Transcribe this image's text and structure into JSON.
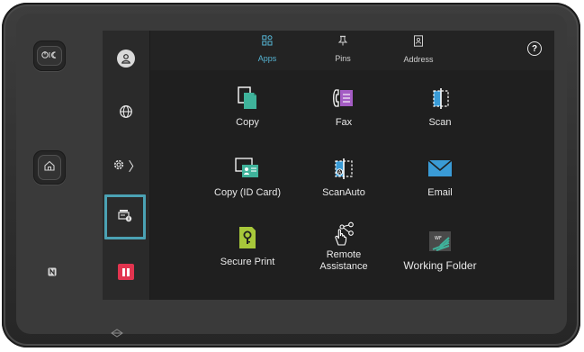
{
  "tabs": [
    {
      "label": "Apps",
      "icon": "apps-grid-icon",
      "active": true
    },
    {
      "label": "Pins",
      "icon": "pin-icon",
      "active": false
    },
    {
      "label": "Address",
      "icon": "address-book-icon",
      "active": false
    }
  ],
  "help_glyph": "?",
  "sidebar": {
    "items": [
      {
        "name": "user-profile",
        "icon": "user-icon"
      },
      {
        "name": "language",
        "icon": "globe-icon"
      },
      {
        "name": "device-settings",
        "icon": "gear-icon",
        "chevron": "〉"
      },
      {
        "name": "job-status",
        "icon": "printer-info-icon",
        "selected": true
      },
      {
        "name": "stop",
        "icon": "stop-icon",
        "color": "#e2344f"
      }
    ]
  },
  "apps": [
    {
      "label": "Copy",
      "icon": "copy-icon"
    },
    {
      "label": "Fax",
      "icon": "fax-icon"
    },
    {
      "label": "Scan",
      "icon": "scan-icon"
    },
    {
      "label": "Copy (ID Card)",
      "icon": "id-card-copy-icon"
    },
    {
      "label": "ScanAuto",
      "icon": "scan-auto-icon"
    },
    {
      "label": "Email",
      "icon": "email-icon"
    },
    {
      "label": "Secure Print",
      "icon": "secure-print-icon"
    },
    {
      "label": "Remote\nAssistance",
      "icon": "remote-assistance-icon"
    },
    {
      "label": "Working Folder",
      "icon": "working-folder-icon"
    }
  ],
  "hardware": {
    "power_button": "power-sleep-icon",
    "home_button": "home-icon",
    "nfc": "nfc-icon"
  },
  "colors": {
    "accent": "#56b4d3",
    "selection": "#4ba2b4",
    "stop": "#e2344f",
    "copy_icon": "#3fb39b",
    "fax_icon": "#a45cc4",
    "secure_print_icon": "#a8c83a",
    "email_icon": "#3a9bd6"
  }
}
